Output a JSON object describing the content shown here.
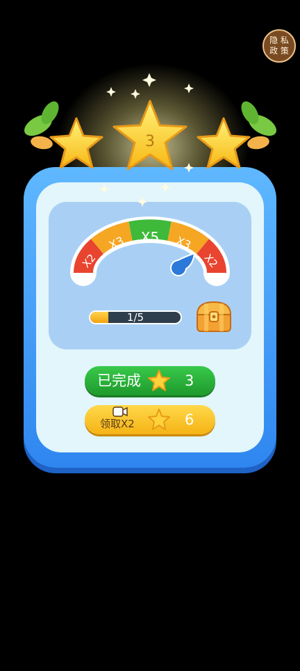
{
  "privacy": {
    "line1": "隐 私",
    "line2": "政 策"
  },
  "level_number": "3",
  "stars_earned": 3,
  "multiplier_gauge": {
    "segments": [
      {
        "label": "X2",
        "color": "#e8442f"
      },
      {
        "label": "X3",
        "color": "#f5a623"
      },
      {
        "label": "X5",
        "color": "#3fb93a"
      },
      {
        "label": "X3",
        "color": "#f5a623"
      },
      {
        "label": "X2",
        "color": "#e8442f"
      }
    ]
  },
  "progress": {
    "label": "1/5",
    "current": 1,
    "total": 5
  },
  "buttons": {
    "done": {
      "label": "已完成",
      "count": "3"
    },
    "claim_double": {
      "label": "领取X2",
      "count": "6"
    }
  },
  "colors": {
    "card_blue": "#2f86f0",
    "card_inner": "#e2f6fb",
    "green_button": "#39c94b",
    "yellow_button": "#ffd84a",
    "star_yellow": "#ffd23a"
  }
}
